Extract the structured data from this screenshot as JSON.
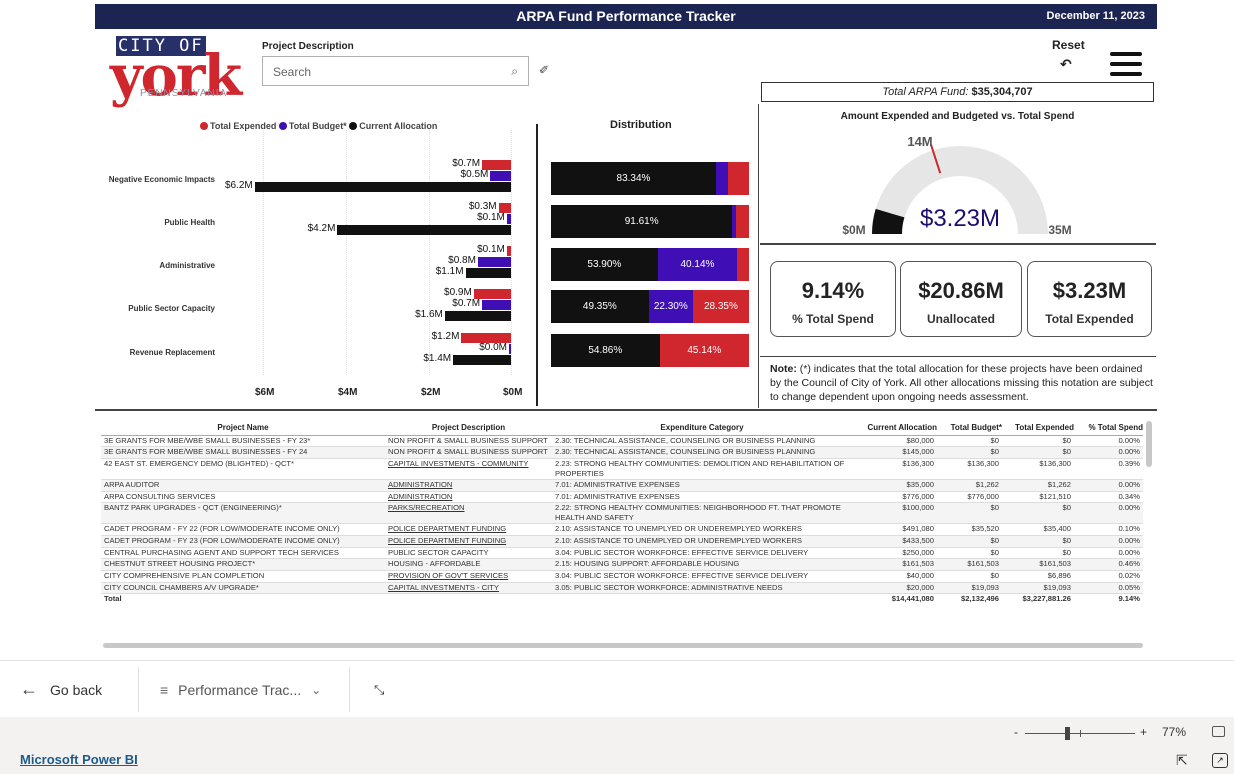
{
  "report": {
    "title": "ARPA Fund Performance Tracker",
    "date": "December 11, 2023",
    "logo": {
      "city": "CITY OF",
      "york": "york",
      "state": "PENNSYLVANIA"
    },
    "filter": {
      "label": "Project Description",
      "placeholder": "Search"
    },
    "reset_label": "Reset",
    "total_fund_label": "Total ARPA Fund:",
    "total_fund_value": "$35,304,707"
  },
  "legend": {
    "items": [
      {
        "label": "Total Expended",
        "color": "#d0262e"
      },
      {
        "label": "Total Budget*",
        "color": "#3f0fb5"
      },
      {
        "label": "Current Allocation",
        "color": "#111111"
      }
    ]
  },
  "colors": {
    "expended": "#d0262e",
    "budget": "#3f0fb5",
    "allocation": "#111111",
    "header": "#1c2452",
    "gauge": "#1c0d6e"
  },
  "chart_data": [
    {
      "type": "bar",
      "orientation": "horizontal",
      "categories": [
        "Negative Economic Impacts",
        "Public Health",
        "Administrative",
        "Public Sector Capacity",
        "Revenue Replacement"
      ],
      "series": [
        {
          "name": "Total Expended",
          "values": [
            0.7,
            0.3,
            0.1,
            0.9,
            1.2
          ]
        },
        {
          "name": "Total Budget*",
          "values": [
            0.5,
            0.1,
            0.8,
            0.7,
            0.0
          ]
        },
        {
          "name": "Current Allocation",
          "values": [
            6.2,
            4.2,
            1.1,
            1.6,
            1.4
          ]
        }
      ],
      "value_labels": {
        "Total Expended": [
          "$0.7M",
          "$0.3M",
          "$0.1M",
          "$0.9M",
          "$1.2M"
        ],
        "Total Budget*": [
          "$0.5M",
          "$0.1M",
          "$0.8M",
          "$0.7M",
          "$0.0M"
        ],
        "Current Allocation": [
          "$6.2M",
          "$4.2M",
          "$1.1M",
          "$1.6M",
          "$1.4M"
        ]
      },
      "xticks": [
        "$6M",
        "$4M",
        "$2M",
        "$0M"
      ],
      "xlim": [
        0,
        6
      ],
      "xaxis_reversed": true
    },
    {
      "type": "bar",
      "stacked": true,
      "normalized": true,
      "title": "Distribution",
      "rows": [
        {
          "allocation": 83.34,
          "budget": 6.0,
          "expended": 10.66,
          "labels": [
            "83.34%",
            "",
            ""
          ]
        },
        {
          "allocation": 91.61,
          "budget": 2.0,
          "expended": 6.39,
          "labels": [
            "91.61%",
            "",
            ""
          ]
        },
        {
          "allocation": 53.9,
          "budget": 40.14,
          "expended": 5.96,
          "labels": [
            "53.90%",
            "40.14%",
            ""
          ]
        },
        {
          "allocation": 49.35,
          "budget": 22.3,
          "expended": 28.35,
          "labels": [
            "49.35%",
            "22.30%",
            "28.35%"
          ]
        },
        {
          "allocation": 54.86,
          "budget": 0,
          "expended": 45.14,
          "labels": [
            "54.86%",
            "",
            "45.14%"
          ]
        }
      ]
    },
    {
      "type": "gauge",
      "title": "Amount Expended and Budgeted vs. Total Spend",
      "value": 3.23,
      "target": 14,
      "min": 0,
      "max": 35,
      "value_label": "$3.23M",
      "target_label": "14M",
      "min_label": "$0M",
      "max_label": "35M"
    }
  ],
  "kpis": [
    {
      "value": "9.14%",
      "label": "% Total Spend"
    },
    {
      "value": "$20.86M",
      "label": "Unallocated"
    },
    {
      "value": "$3.23M",
      "label": "Total Expended"
    }
  ],
  "note": {
    "bold": "Note:",
    "text": " (*) indicates that the  total allocation for these projects have been ordained by the Council of City of York. All other allocations missing this notation are subject to change dependent upon ongoing needs assessment."
  },
  "table": {
    "headers": [
      "Project Name",
      "Project Description",
      "Expenditure Category",
      "Current Allocation",
      "Total Budget*",
      "Total Expended",
      "% Total Spend"
    ],
    "rows": [
      [
        "3E GRANTS FOR MBE/WBE SMALL BUSINESSES - FY 23*",
        "NON PROFIT & SMALL BUSINESS SUPPORT",
        "2.30: TECHNICAL ASSISTANCE, COUNSELING OR BUSINESS PLANNING",
        "$80,000",
        "$0",
        "$0",
        "0.00%"
      ],
      [
        "3E GRANTS FOR MBE/WBE SMALL BUSINESSES - FY 24",
        "NON PROFIT & SMALL BUSINESS SUPPORT",
        "2.30: TECHNICAL ASSISTANCE, COUNSELING OR BUSINESS PLANNING",
        "$145,000",
        "$0",
        "$0",
        "0.00%"
      ],
      [
        "42 EAST ST. EMERGENCY DEMO (BLIGHTED) - QCT*",
        "CAPITAL INVESTMENTS - COMMUNITY",
        "2.23: STRONG HEALTHY COMMUNITIES: DEMOLITION AND REHABILITATION OF PROPERTIES",
        "$136,300",
        "$136,300",
        "$136,300",
        "0.39%"
      ],
      [
        "ARPA AUDITOR",
        "ADMINISTRATION",
        "7.01: ADMINISTRATIVE EXPENSES",
        "$35,000",
        "$1,262",
        "$1,262",
        "0.00%"
      ],
      [
        "ARPA CONSULTING SERVICES",
        "ADMINISTRATION",
        "7.01: ADMINISTRATIVE EXPENSES",
        "$776,000",
        "$776,000",
        "$121,510",
        "0.34%"
      ],
      [
        "BANTZ PARK UPGRADES - QCT (ENGINEERING)*",
        "PARKS/RECREATION",
        "2.22: STRONG HEALTHY COMMUNITIES: NEIGHBORHOOD FT. THAT PROMOTE HEALTH AND SAFETY",
        "$100,000",
        "$0",
        "$0",
        "0.00%"
      ],
      [
        "CADET PROGRAM - FY 22 (FOR LOW/MODERATE INCOME ONLY)",
        "POLICE DEPARTMENT FUNDING",
        "2.10: ASSISTANCE TO UNEMPLYED OR UNDEREMPLYED WORKERS",
        "$491,080",
        "$35,520",
        "$35,400",
        "0.10%"
      ],
      [
        "CADET PROGRAM - FY 23 (FOR LOW/MODERATE INCOME ONLY)",
        "POLICE DEPARTMENT FUNDING",
        "2.10: ASSISTANCE TO UNEMPLYED OR UNDEREMPLYED WORKERS",
        "$433,500",
        "$0",
        "$0",
        "0.00%"
      ],
      [
        "CENTRAL PURCHASING AGENT AND SUPPORT TECH SERVICES",
        "PUBLIC SECTOR CAPACITY",
        "3.04: PUBLIC SECTOR WORKFORCE: EFFECTIVE SERVICE DELIVERY",
        "$250,000",
        "$0",
        "$0",
        "0.00%"
      ],
      [
        "CHESTNUT STREET HOUSING PROJECT*",
        "HOUSING - AFFORDABLE",
        "2.15: HOUSING SUPPORT: AFFORDABLE HOUSING",
        "$161,503",
        "$161,503",
        "$161,503",
        "0.46%"
      ],
      [
        "CITY COMPREHENSIVE PLAN COMPLETION",
        "PROVISION OF GOV'T SERVICES",
        "3.04: PUBLIC SECTOR WORKFORCE: EFFECTIVE SERVICE DELIVERY",
        "$40,000",
        "$0",
        "$6,896",
        "0.02%"
      ],
      [
        "CITY COUNCIL CHAMBERS A/V UPGRADE*",
        "CAPITAL INVESTMENTS - CITY",
        "3.05: PUBLIC SECTOR WORKFORCE: ADMINISTRATIVE NEEDS",
        "$20,000",
        "$19,093",
        "$19,093",
        "0.05%"
      ]
    ],
    "underlined_desc": [
      false,
      false,
      true,
      true,
      true,
      true,
      true,
      true,
      false,
      false,
      true,
      true
    ],
    "total": [
      "Total",
      "",
      "",
      "$14,441,080",
      "$2,132,496",
      "$3,227,881.26",
      "9.14%"
    ]
  },
  "nav": {
    "back": "Go back",
    "page": "Performance Trac...",
    "chevron": "⌄",
    "collapse": "⤡"
  },
  "status": {
    "zoom_minus": "-",
    "zoom_plus": "+",
    "zoom": "77%",
    "zoom_level": 0.77,
    "brand": "Microsoft Power BI"
  }
}
